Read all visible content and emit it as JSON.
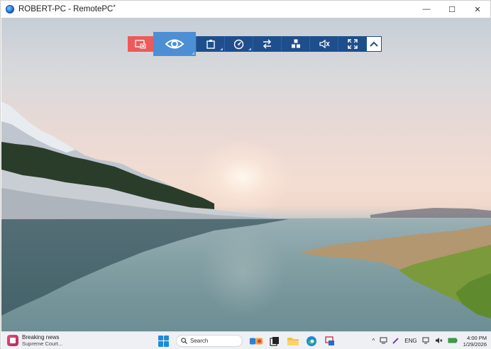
{
  "window": {
    "title": "ROBERT-PC - RemotePC",
    "title_suffix": "*",
    "controls": {
      "minimize": "—",
      "maximize": "☐",
      "close": "✕"
    }
  },
  "remote_toolbar": {
    "buttons": [
      {
        "name": "disconnect",
        "icon": "disconnect-icon",
        "color": "#ec5a5a"
      },
      {
        "name": "view",
        "icon": "eye-icon",
        "color": "#4d8fd4"
      },
      {
        "name": "clipboard",
        "icon": "clipboard-icon",
        "color": "#1e4e8c"
      },
      {
        "name": "performance",
        "icon": "gauge-icon",
        "color": "#1e4e8c"
      },
      {
        "name": "transfer",
        "icon": "transfer-arrows-icon",
        "color": "#1e4e8c"
      },
      {
        "name": "actions",
        "icon": "grid-icon",
        "color": "#1e4e8c"
      },
      {
        "name": "sound",
        "icon": "speaker-muted-icon",
        "color": "#1e4e8c"
      },
      {
        "name": "fullscreen",
        "icon": "expand-icon",
        "color": "#1e4e8c"
      },
      {
        "name": "collapse",
        "icon": "chevron-up-icon",
        "color": "#ffffff"
      }
    ]
  },
  "taskbar": {
    "news": {
      "title": "Breaking news",
      "subtitle": "Supreme Court..."
    },
    "search_label": "Search",
    "apps": [
      "widgets-icon",
      "task-view-icon",
      "file-explorer-icon",
      "edge-icon",
      "remotepc-icon"
    ],
    "tray": {
      "chevron": "^",
      "language": "ENG",
      "time": "4:00 PM",
      "date": "1/29/2026"
    }
  }
}
